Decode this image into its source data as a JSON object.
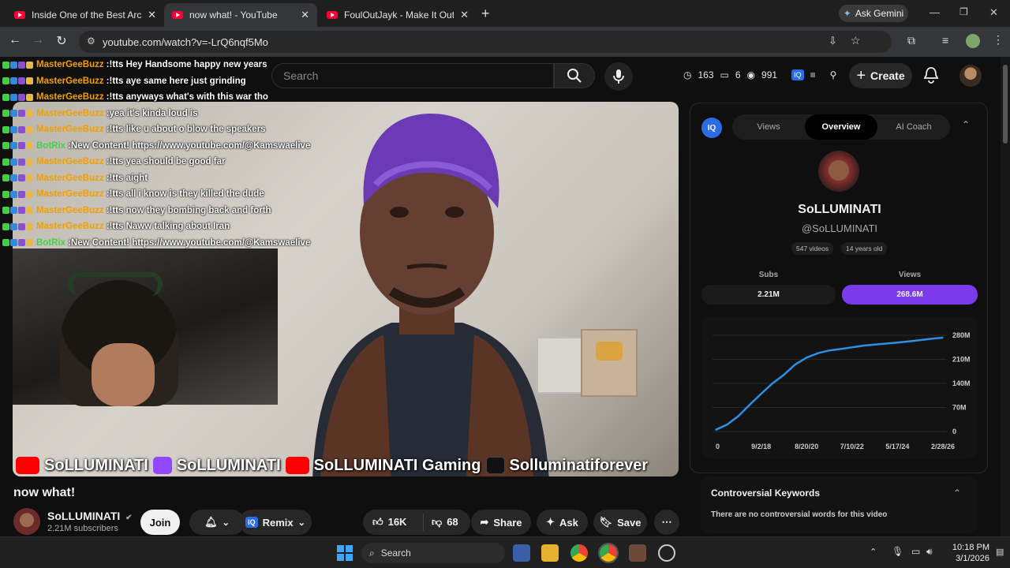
{
  "browser": {
    "tabs": [
      {
        "title": "Inside One of the Best Architect"
      },
      {
        "title": "now what! - YouTube"
      },
      {
        "title": "FoulOutJayk - Make It Out - You"
      }
    ],
    "ask_gemini": "Ask Gemini",
    "url": "youtube.com/watch?v=-LrQ6nqf5Mo"
  },
  "youtube": {
    "search_placeholder": "Search",
    "stats": {
      "views_icon_value": "163",
      "second": "6",
      "third": "991"
    },
    "create_label": "Create",
    "video_title": "now what!",
    "channel": {
      "name": "SoLLUMINATI",
      "subscribers": "2.21M subscribers",
      "join_label": "Join",
      "remix_label": "Remix"
    },
    "actions": {
      "likes": "16K",
      "dislikes": "68",
      "share": "Share",
      "ask": "Ask",
      "save": "Save"
    }
  },
  "video_overlay": {
    "chat": [
      {
        "user": "MasterGeeBuzz",
        "text": "!tts Hey Handsome happy new years",
        "color": "#f0a000"
      },
      {
        "user": "MasterGeeBuzz",
        "text": "!tts aye same here just grinding",
        "color": "#f0a000"
      },
      {
        "user": "MasterGeeBuzz",
        "text": "!tts anyways what's with this war tho",
        "color": "#f0a000"
      },
      {
        "user": "MasterGeeBuzz",
        "text": "yea it's kinda loud is",
        "color": "#f0a000"
      },
      {
        "user": "MasterGeeBuzz",
        "text": "!tts like u about o blow the speakers",
        "color": "#f0a000"
      },
      {
        "user": "BotRix",
        "text": "New Content! https://www.youtube.com/@Kamswaelive",
        "color": "#45d04a"
      },
      {
        "user": "MasterGeeBuzz",
        "text": "!tts yea should be good far",
        "color": "#f0a000"
      },
      {
        "user": "MasterGeeBuzz",
        "text": "!tts aight",
        "color": "#f0a000"
      },
      {
        "user": "MasterGeeBuzz",
        "text": "!tts all i know is they killed the dude",
        "color": "#f0a000"
      },
      {
        "user": "MasterGeeBuzz",
        "text": "!tts now they bombing back and forth",
        "color": "#f0a000"
      },
      {
        "user": "MasterGeeBuzz",
        "text": "!tts Naww talking about Iran",
        "color": "#f0a000"
      },
      {
        "user": "BotRix",
        "text": "New Content! https://www.youtube.com/@Kamswaelive",
        "color": "#45d04a"
      }
    ],
    "banner": [
      "SoLLUMINATI",
      "SoLLUMINATI",
      "SoLLUMINATI Gaming",
      "Solluminatiforever"
    ]
  },
  "side_panel": {
    "tabs": [
      "Views",
      "Overview",
      "AI Coach"
    ],
    "active_tab": "Overview",
    "channel_name": "SoLLUMINATI",
    "handle": "@SoLLUMINATI",
    "video_count": "547 videos",
    "age": "14 years old",
    "subs_label": "Subs",
    "subs_value": "2.21M",
    "views_label": "Views",
    "views_value": "268.6M",
    "keywords_title": "Controversial Keywords",
    "keywords_text": "There are no controversial words for this video"
  },
  "chart_data": {
    "type": "line",
    "x_ticks": [
      "0",
      "9/2/18",
      "8/20/20",
      "7/10/22",
      "5/17/24",
      "2/28/26"
    ],
    "y_ticks": [
      "0",
      "70M",
      "140M",
      "210M",
      "280M"
    ],
    "ylim": [
      0,
      280
    ],
    "x": [
      0,
      0.05,
      0.1,
      0.15,
      0.2,
      0.25,
      0.3,
      0.35,
      0.4,
      0.45,
      0.5,
      0.55,
      0.6,
      0.65,
      0.7,
      0.75,
      0.8,
      0.85,
      0.9,
      0.95,
      1.0
    ],
    "values": [
      5,
      20,
      45,
      78,
      110,
      140,
      165,
      195,
      215,
      228,
      236,
      240,
      245,
      250,
      253,
      256,
      259,
      262,
      266,
      270,
      273
    ],
    "grid": true,
    "color": "#2f8fe3"
  },
  "taskbar": {
    "search": "Search",
    "time": "10:18 PM",
    "date": "3/1/2026"
  }
}
